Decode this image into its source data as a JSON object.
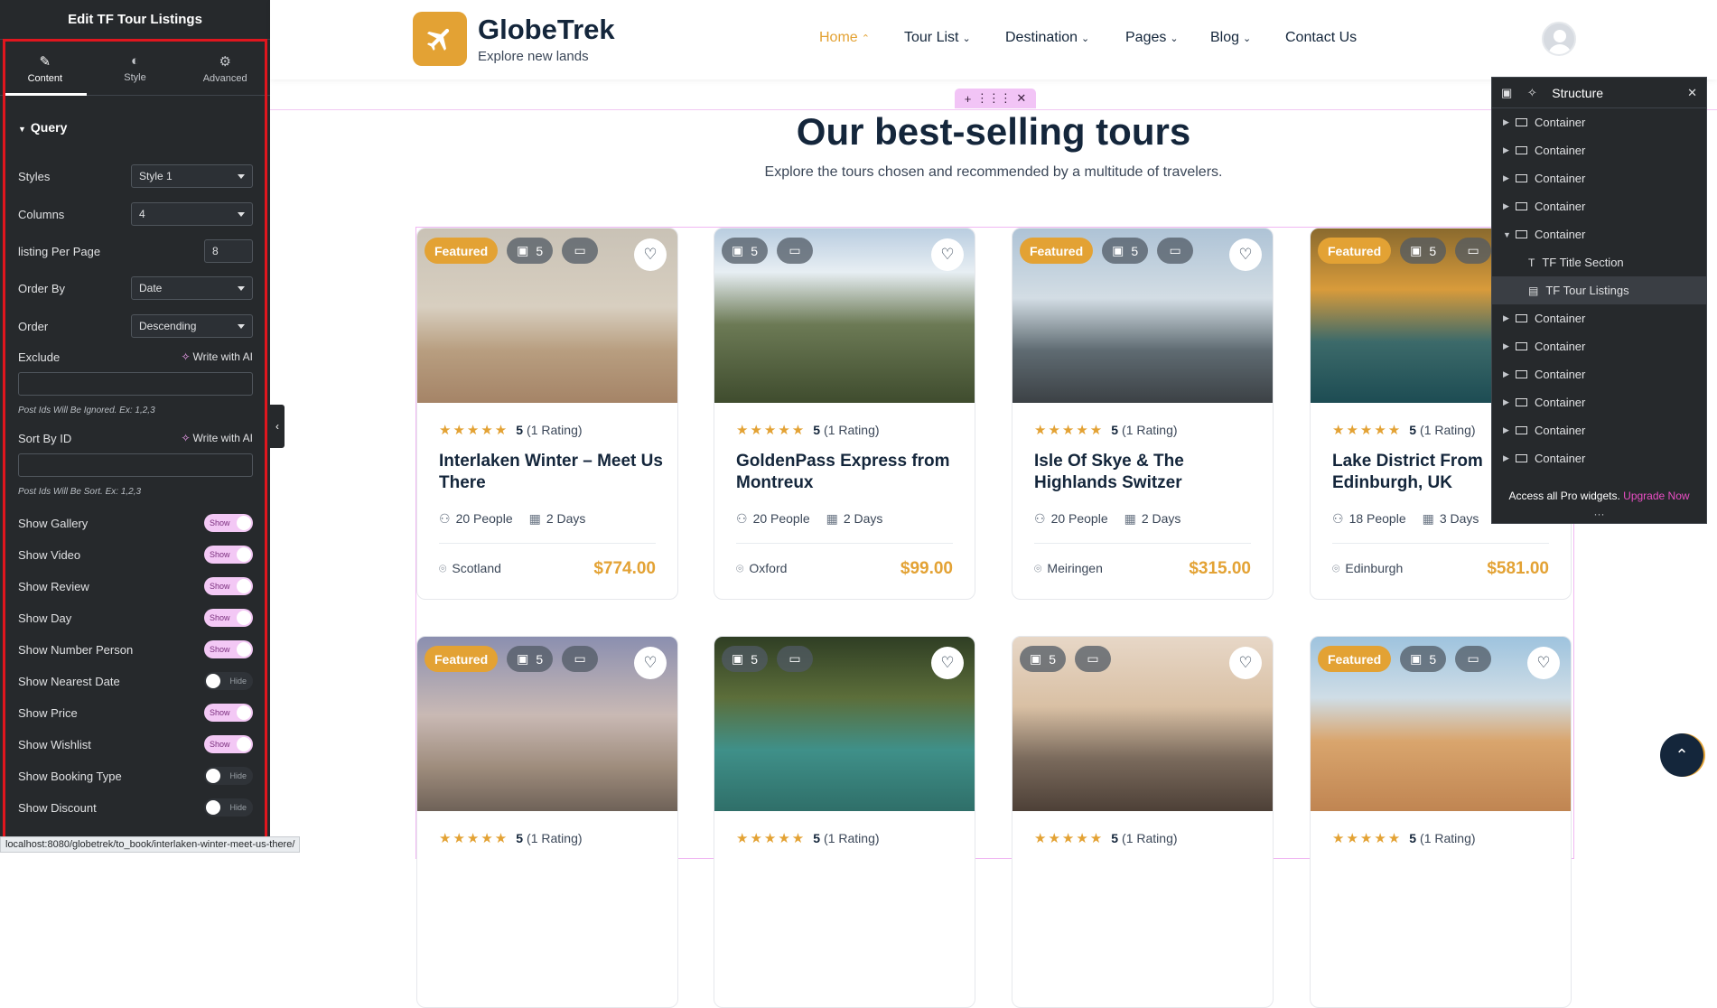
{
  "panel": {
    "title": "Edit TF Tour Listings",
    "tabs": [
      {
        "label": "Content",
        "icon": "pencil-icon"
      },
      {
        "label": "Style",
        "icon": "half-circle-icon"
      },
      {
        "label": "Advanced",
        "icon": "gear-icon"
      }
    ],
    "section": "Query",
    "fields": {
      "styles": {
        "label": "Styles",
        "value": "Style 1"
      },
      "columns": {
        "label": "Columns",
        "value": "4"
      },
      "per_page": {
        "label": "listing Per Page",
        "value": "8"
      },
      "order_by": {
        "label": "Order By",
        "value": "Date"
      },
      "order": {
        "label": "Order",
        "value": "Descending"
      },
      "exclude": {
        "label": "Exclude",
        "ai": "Write with AI",
        "hint": "Post Ids Will Be Ignored. Ex: 1,2,3"
      },
      "sort_by_id": {
        "label": "Sort By ID",
        "ai": "Write with AI",
        "hint": "Post Ids Will Be Sort. Ex: 1,2,3"
      }
    },
    "toggles": [
      {
        "label": "Show Gallery",
        "state": "Show",
        "on": true
      },
      {
        "label": "Show Video",
        "state": "Show",
        "on": true
      },
      {
        "label": "Show Review",
        "state": "Show",
        "on": true
      },
      {
        "label": "Show Day",
        "state": "Show",
        "on": true
      },
      {
        "label": "Show Number Person",
        "state": "Show",
        "on": true
      },
      {
        "label": "Show Nearest Date",
        "state": "Hide",
        "on": false
      },
      {
        "label": "Show Price",
        "state": "Show",
        "on": true
      },
      {
        "label": "Show Wishlist",
        "state": "Show",
        "on": true
      },
      {
        "label": "Show Booking Type",
        "state": "Hide",
        "on": false
      },
      {
        "label": "Show Discount",
        "state": "Hide",
        "on": false
      }
    ],
    "status_url": "localhost:8080/globetrek/to_book/interlaken-winter-meet-us-there/"
  },
  "site": {
    "brand": "GlobeTrek",
    "tagline": "Explore new lands",
    "nav": [
      {
        "label": "Home",
        "active": true,
        "chevron": "⌃"
      },
      {
        "label": "Tour List",
        "active": false,
        "chevron": "⌄"
      },
      {
        "label": "Destination",
        "active": false,
        "chevron": "⌄"
      },
      {
        "label": "Pages",
        "active": false,
        "chevron": "⌄"
      },
      {
        "label": "Blog",
        "active": false,
        "chevron": "⌄"
      },
      {
        "label": "Contact Us",
        "active": false,
        "chevron": ""
      }
    ],
    "heading": "Our best-selling tours",
    "subheading": "Explore the tours chosen and recommended by a multitude of travelers.",
    "accent": "#e3a234"
  },
  "tours": [
    {
      "featured": "Featured",
      "gallery": "5",
      "rating": "5",
      "rating_count": "(1 Rating)",
      "title": "Interlaken Winter – Meet Us There",
      "people": "20 People",
      "days": "2 Days",
      "location": "Scotland",
      "price": "$774.00",
      "img": "desert"
    },
    {
      "featured": "",
      "gallery": "5",
      "rating": "5",
      "rating_count": "(1 Rating)",
      "title": "GoldenPass Express from Montreux",
      "people": "20 People",
      "days": "2 Days",
      "location": "Oxford",
      "price": "$99.00",
      "img": "mountain"
    },
    {
      "featured": "Featured",
      "gallery": "5",
      "rating": "5",
      "rating_count": "(1 Rating)",
      "title": "Isle Of Skye & The Highlands Switzer",
      "people": "20 People",
      "days": "2 Days",
      "location": "Meiringen",
      "price": "$315.00",
      "img": "peak"
    },
    {
      "featured": "Featured",
      "gallery": "5",
      "rating": "5",
      "rating_count": "(1 Rating)",
      "title": "Lake District From Edinburgh, UK",
      "people": "18 People",
      "days": "3 Days",
      "location": "Edinburgh",
      "price": "$581.00",
      "img": "lake"
    },
    {
      "featured": "Featured",
      "gallery": "5",
      "rating": "5",
      "rating_count": "(1 Rating)",
      "title": "",
      "people": "",
      "days": "",
      "location": "",
      "price": "",
      "img": "cappadocia"
    },
    {
      "featured": "",
      "gallery": "5",
      "rating": "5",
      "rating_count": "(1 Rating)",
      "title": "",
      "people": "",
      "days": "",
      "location": "",
      "price": "",
      "img": "boats"
    },
    {
      "featured": "",
      "gallery": "5",
      "rating": "5",
      "rating_count": "(1 Rating)",
      "title": "",
      "people": "",
      "days": "",
      "location": "",
      "price": "",
      "img": "balloon"
    },
    {
      "featured": "Featured",
      "gallery": "5",
      "rating": "5",
      "rating_count": "(1 Rating)",
      "title": "",
      "people": "",
      "days": "",
      "location": "",
      "price": "",
      "img": "dunes"
    }
  ],
  "structure": {
    "title": "Structure",
    "items": [
      {
        "label": "Container",
        "expanded": false,
        "child": false,
        "selected": false
      },
      {
        "label": "Container",
        "expanded": false,
        "child": false,
        "selected": false
      },
      {
        "label": "Container",
        "expanded": false,
        "child": false,
        "selected": false
      },
      {
        "label": "Container",
        "expanded": false,
        "child": false,
        "selected": false
      },
      {
        "label": "Container",
        "expanded": true,
        "child": false,
        "selected": false
      },
      {
        "label": "TF Title Section",
        "expanded": false,
        "child": true,
        "selected": false
      },
      {
        "label": "TF Tour Listings",
        "expanded": false,
        "child": true,
        "selected": true
      },
      {
        "label": "Container",
        "expanded": false,
        "child": false,
        "selected": false
      },
      {
        "label": "Container",
        "expanded": false,
        "child": false,
        "selected": false
      },
      {
        "label": "Container",
        "expanded": false,
        "child": false,
        "selected": false
      },
      {
        "label": "Container",
        "expanded": false,
        "child": false,
        "selected": false
      },
      {
        "label": "Container",
        "expanded": false,
        "child": false,
        "selected": false
      },
      {
        "label": "Container",
        "expanded": false,
        "child": false,
        "selected": false
      }
    ],
    "footer_text": "Access all Pro widgets.",
    "footer_link": "Upgrade Now"
  }
}
